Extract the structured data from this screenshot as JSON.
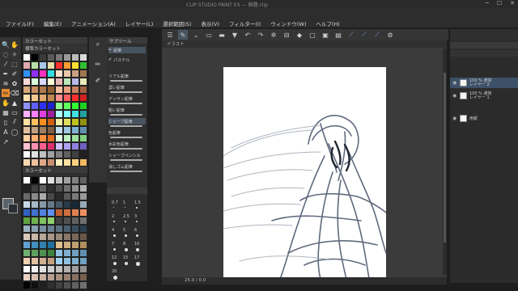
{
  "window": {
    "title": "CLIP STUDIO PAINT EX — 無題.clip"
  },
  "menu": [
    "ファイル(F)",
    "編集(E)",
    "アニメーション(A)",
    "レイヤー(L)",
    "選択範囲(S)",
    "表示(V)",
    "フィルター(I)",
    "ウィンドウ(W)",
    "ヘルプ(H)"
  ],
  "colorset": {
    "header": "カラーセット",
    "subheader": "標準カラーセット"
  },
  "colorset2": {
    "header": "カラーセット"
  },
  "subtool": {
    "header": "サブツール",
    "groups": [
      "鉛筆",
      "パステル"
    ],
    "items": [
      "リアル鉛筆",
      "濃い鉛筆",
      "デッサン鉛筆",
      "粗い鉛筆",
      "シャープ鉛筆",
      "色鉛筆",
      "水彩色鉛筆",
      "シャープペンシル",
      "消しゴム鉛筆"
    ]
  },
  "brushsize": {
    "values": [
      "0.7",
      "1",
      "1.5",
      "2",
      "2.5",
      "3",
      "4",
      "5",
      "6",
      "7",
      "8",
      "10",
      "12",
      "15",
      "17",
      "20"
    ]
  },
  "canvas": {
    "tab_label": "イラスト",
    "status": "25.0 / 0.0"
  },
  "layers": {
    "items": [
      {
        "name": "100 % 通常\nレイヤー 2",
        "active": true
      },
      {
        "name": "100 % 通常\nレイヤー 1",
        "active": false
      },
      {
        "name": "用紙",
        "active": false
      }
    ]
  },
  "colors": {
    "accent": "#e88a2d",
    "paper": "#ffffff",
    "sketch": "#4e5a70"
  }
}
